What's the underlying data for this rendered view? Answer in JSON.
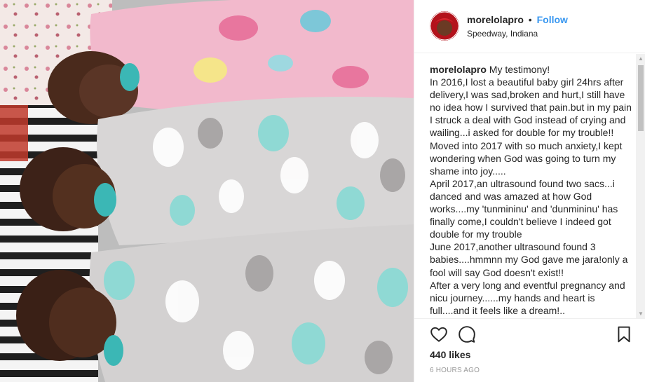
{
  "colors": {
    "follow_blue": "#3897f0",
    "text": "#262626",
    "muted": "#999999",
    "border": "#efefef"
  },
  "post": {
    "image_alt": "Three swaddled sleeping babies with pacifiers"
  },
  "header": {
    "username": "morelolapro",
    "separator": "•",
    "follow_label": "Follow",
    "location": "Speedway, Indiana"
  },
  "caption": {
    "username": "morelolapro",
    "text": "My testimony!\nIn 2016,I lost a beautiful baby girl 24hrs after delivery,I was sad,broken and hurt,I still have no idea how I survived that pain.but in my pain I struck a deal with God instead of crying and wailing...i asked for double for my trouble!!\nMoved into 2017 with so much anxiety,I kept wondering when God was going to turn my shame into joy.....\nApril 2017,an ultrasound found two sacs...i danced and was amazed at how God works....my 'tunmininu' and 'dunmininu' has finally come,I couldn't believe I indeed got double for my trouble\nJune 2017,another ultrasound found 3 babies....hmmnn my God gave me jara!only a fool will say God doesn't exist!!\nAfter a very long and eventful pregnancy and nicu journey......my hands and heart is full....and it feels like a dream!.."
  },
  "actions": {
    "like_icon": "heart-icon",
    "comment_icon": "comment-icon",
    "save_icon": "bookmark-icon"
  },
  "likes": "440 likes",
  "timestamp": "6 HOURS AGO"
}
